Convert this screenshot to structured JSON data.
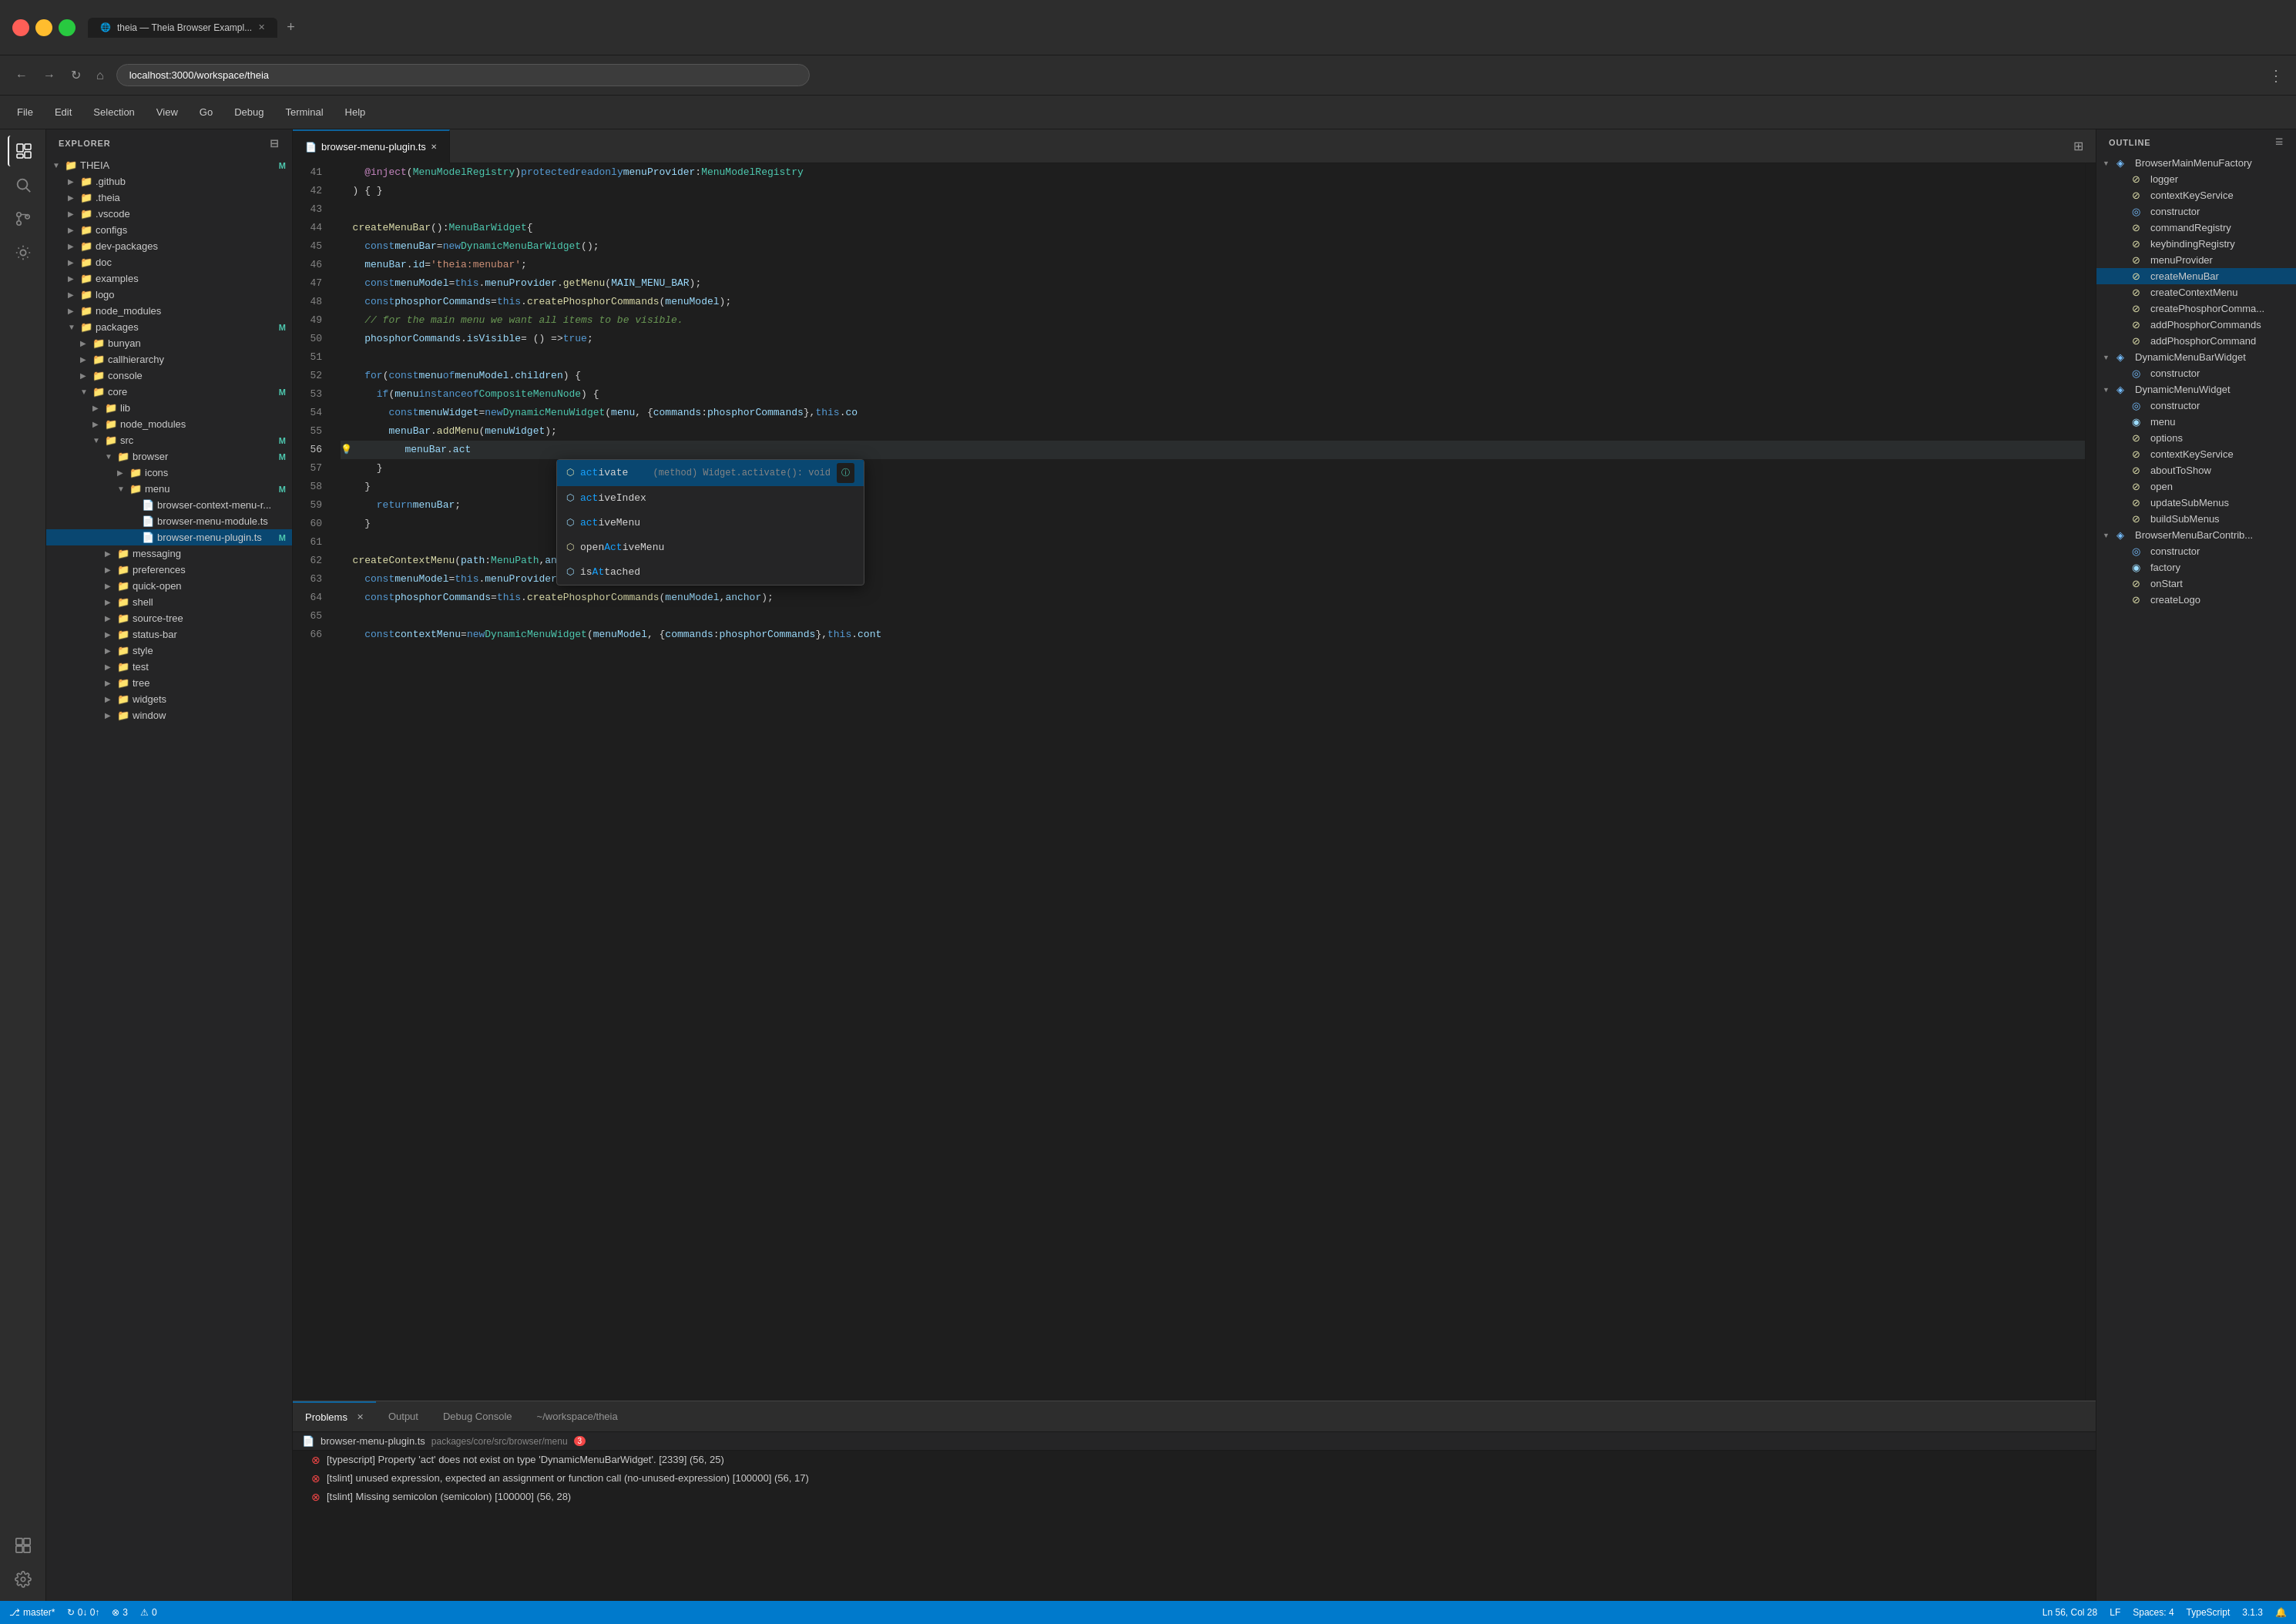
{
  "window": {
    "title": "theia — Theia Browser Exampl...",
    "url": "localhost:3000/workspace/theia"
  },
  "menu": {
    "items": [
      "File",
      "Edit",
      "Selection",
      "View",
      "Go",
      "Debug",
      "Terminal",
      "Help"
    ]
  },
  "sidebar": {
    "header": "EXPLORER",
    "root": "THEIA",
    "items": [
      {
        "label": ".github",
        "indent": 2,
        "type": "folder"
      },
      {
        "label": ".theia",
        "indent": 2,
        "type": "folder"
      },
      {
        "label": ".vscode",
        "indent": 2,
        "type": "folder"
      },
      {
        "label": "configs",
        "indent": 2,
        "type": "folder"
      },
      {
        "label": "dev-packages",
        "indent": 2,
        "type": "folder"
      },
      {
        "label": "doc",
        "indent": 2,
        "type": "folder"
      },
      {
        "label": "examples",
        "indent": 2,
        "type": "folder"
      },
      {
        "label": "logo",
        "indent": 2,
        "type": "folder"
      },
      {
        "label": "node_modules",
        "indent": 2,
        "type": "folder"
      },
      {
        "label": "packages",
        "indent": 2,
        "type": "folder",
        "badge": "M"
      },
      {
        "label": "bunyan",
        "indent": 4,
        "type": "folder"
      },
      {
        "label": "callhierarchy",
        "indent": 4,
        "type": "folder"
      },
      {
        "label": "console",
        "indent": 4,
        "type": "folder"
      },
      {
        "label": "core",
        "indent": 4,
        "type": "folder",
        "badge": "M"
      },
      {
        "label": "lib",
        "indent": 6,
        "type": "folder"
      },
      {
        "label": "node_modules",
        "indent": 6,
        "type": "folder"
      },
      {
        "label": "src",
        "indent": 6,
        "type": "folder",
        "badge": "M"
      },
      {
        "label": "browser",
        "indent": 8,
        "type": "folder",
        "badge": "M"
      },
      {
        "label": "icons",
        "indent": 10,
        "type": "folder"
      },
      {
        "label": "menu",
        "indent": 10,
        "type": "folder",
        "badge": "M"
      },
      {
        "label": "browser-context-menu-r...",
        "indent": 12,
        "type": "file"
      },
      {
        "label": "browser-menu-module.ts",
        "indent": 12,
        "type": "file"
      },
      {
        "label": "browser-menu-plugin.ts",
        "indent": 12,
        "type": "file",
        "badge": "M",
        "active": true
      },
      {
        "label": "messaging",
        "indent": 8,
        "type": "folder"
      },
      {
        "label": "preferences",
        "indent": 8,
        "type": "folder"
      },
      {
        "label": "quick-open",
        "indent": 8,
        "type": "folder"
      },
      {
        "label": "shell",
        "indent": 8,
        "type": "folder"
      },
      {
        "label": "source-tree",
        "indent": 8,
        "type": "folder"
      },
      {
        "label": "status-bar",
        "indent": 8,
        "type": "folder"
      },
      {
        "label": "style",
        "indent": 8,
        "type": "folder"
      },
      {
        "label": "test",
        "indent": 8,
        "type": "folder"
      },
      {
        "label": "tree",
        "indent": 8,
        "type": "folder"
      },
      {
        "label": "widgets",
        "indent": 8,
        "type": "folder"
      },
      {
        "label": "window",
        "indent": 8,
        "type": "folder"
      }
    ]
  },
  "editor": {
    "tab_name": "browser-menu-plugin.ts",
    "tab_dirty": false,
    "lines": [
      {
        "num": 41,
        "content": "    @inject(MenuModelRegistry) protected readonly menuProvider: MenuModelRegistry"
      },
      {
        "num": 42,
        "content": "  ) { }"
      },
      {
        "num": 43,
        "content": ""
      },
      {
        "num": 44,
        "content": "  createMenuBar(): MenuBarWidget {"
      },
      {
        "num": 45,
        "content": "    const menuBar = new DynamicMenuBarWidget();"
      },
      {
        "num": 46,
        "content": "    menuBar.id = 'theia:menubar';"
      },
      {
        "num": 47,
        "content": "    const menuModel = this.menuProvider.getMenu(MAIN_MENU_BAR);"
      },
      {
        "num": 48,
        "content": "    const phosphorCommands = this.createPhosphorCommands(menuModel);"
      },
      {
        "num": 49,
        "content": "    // for the main menu we want all items to be visible."
      },
      {
        "num": 50,
        "content": "    phosphorCommands.isVisible = () => true;"
      },
      {
        "num": 51,
        "content": ""
      },
      {
        "num": 52,
        "content": "    for (const menu of menuModel.children) {"
      },
      {
        "num": 53,
        "content": "      if (menu instanceof CompositeMenuNode) {"
      },
      {
        "num": 54,
        "content": "        const menuWidget = new DynamicMenuWidget(menu, { commands: phosphorCommands }, this.co"
      },
      {
        "num": 55,
        "content": "        menuBar.addMenu(menuWidget);"
      },
      {
        "num": 56,
        "content": "        menuBar.act",
        "is_current": true,
        "has_bulb": true
      },
      {
        "num": 57,
        "content": "      }"
      },
      {
        "num": 58,
        "content": "    }"
      },
      {
        "num": 59,
        "content": "      return menuBar;"
      },
      {
        "num": 60,
        "content": "    }"
      },
      {
        "num": 61,
        "content": ""
      },
      {
        "num": 62,
        "content": "  createContextMenu(path: MenuPath, anchor?: Anchor): MenuWidget {"
      },
      {
        "num": 63,
        "content": "    const menuModel = this.menuProvider.getMenu(path);"
      },
      {
        "num": 64,
        "content": "    const phosphorCommands = this.createPhosphorCommands(menuModel, anchor);"
      },
      {
        "num": 65,
        "content": ""
      },
      {
        "num": 66,
        "content": "    const contextMenu = new DynamicMenuWidget(menuModel, { commands: phosphorCommands }, this.cont"
      }
    ]
  },
  "autocomplete": {
    "items": [
      {
        "icon": "⬡",
        "label": "activate",
        "type": "(method) Widget.activate(): void",
        "selected": true
      },
      {
        "icon": "⬡",
        "label": "activeIndex",
        "type": ""
      },
      {
        "icon": "⬡",
        "label": "activeMenu",
        "type": ""
      },
      {
        "icon": "⬡",
        "label": "openActiveMenu",
        "type": ""
      },
      {
        "icon": "⬡",
        "label": "isAttached",
        "type": ""
      }
    ]
  },
  "bottom_panel": {
    "tabs": [
      "Problems",
      "Output",
      "Debug Console",
      "~/workspace/theia"
    ],
    "problems_count": 3,
    "file_header": "browser-menu-plugin.ts  packages/core/src/browser/menu  3",
    "errors": [
      "[typescript] Property 'act' does not exist on type 'DynamicMenuBarWidget'. [2339] (56, 25)",
      "[tslint] unused expression, expected an assignment or function call (no-unused-expression) [100000] (56, 17)",
      "[tslint] Missing semicolon (semicolon) [100000] (56, 28)"
    ]
  },
  "outline": {
    "header": "OUTLINE",
    "items": [
      {
        "label": "BrowserMainMenuFactory",
        "icon": "class",
        "indent": 0,
        "expanded": true
      },
      {
        "label": "logger",
        "icon": "property",
        "indent": 1
      },
      {
        "label": "contextKeyService",
        "icon": "method",
        "indent": 1
      },
      {
        "label": "constructor",
        "icon": "constructor",
        "indent": 1
      },
      {
        "label": "commandRegistry",
        "icon": "property",
        "indent": 1
      },
      {
        "label": "keybindingRegistry",
        "icon": "property",
        "indent": 1
      },
      {
        "label": "menuProvider",
        "icon": "property",
        "indent": 1
      },
      {
        "label": "createMenuBar",
        "icon": "method",
        "indent": 1,
        "active": true
      },
      {
        "label": "createContextMenu",
        "icon": "method",
        "indent": 1
      },
      {
        "label": "createPhosphorComma...",
        "icon": "method",
        "indent": 1
      },
      {
        "label": "addPhosphorCommands",
        "icon": "method",
        "indent": 1
      },
      {
        "label": "addPhosphorCommand",
        "icon": "method",
        "indent": 1
      },
      {
        "label": "DynamicMenuBarWidget",
        "icon": "class",
        "indent": 0,
        "expanded": true
      },
      {
        "label": "constructor",
        "icon": "constructor",
        "indent": 1
      },
      {
        "label": "DynamicMenuWidget",
        "icon": "class",
        "indent": 0,
        "expanded": true
      },
      {
        "label": "constructor",
        "icon": "constructor",
        "indent": 1
      },
      {
        "label": "menu",
        "icon": "property",
        "indent": 1
      },
      {
        "label": "options",
        "icon": "property",
        "indent": 1
      },
      {
        "label": "contextKeyService",
        "icon": "method",
        "indent": 1
      },
      {
        "label": "aboutToShow",
        "icon": "method",
        "indent": 1
      },
      {
        "label": "open",
        "icon": "method",
        "indent": 1
      },
      {
        "label": "updateSubMenus",
        "icon": "method",
        "indent": 1
      },
      {
        "label": "buildSubMenus",
        "icon": "method",
        "indent": 1
      },
      {
        "label": "BrowserMenuBarContrib...",
        "icon": "class",
        "indent": 0,
        "expanded": true
      },
      {
        "label": "constructor",
        "icon": "constructor",
        "indent": 1
      },
      {
        "label": "factory",
        "icon": "property",
        "indent": 1
      },
      {
        "label": "onStart",
        "icon": "method",
        "indent": 1
      },
      {
        "label": "createLogo",
        "icon": "method",
        "indent": 1
      }
    ]
  },
  "status_bar": {
    "branch": "master*",
    "sync": "⟳ 0↓ 0↑",
    "errors": "⊗ 3",
    "warnings": "⚠ 0",
    "position": "Ln 56, Col 28",
    "eol": "LF",
    "spaces": "Spaces: 4",
    "language": "TypeScript",
    "version": "3.1.3"
  }
}
